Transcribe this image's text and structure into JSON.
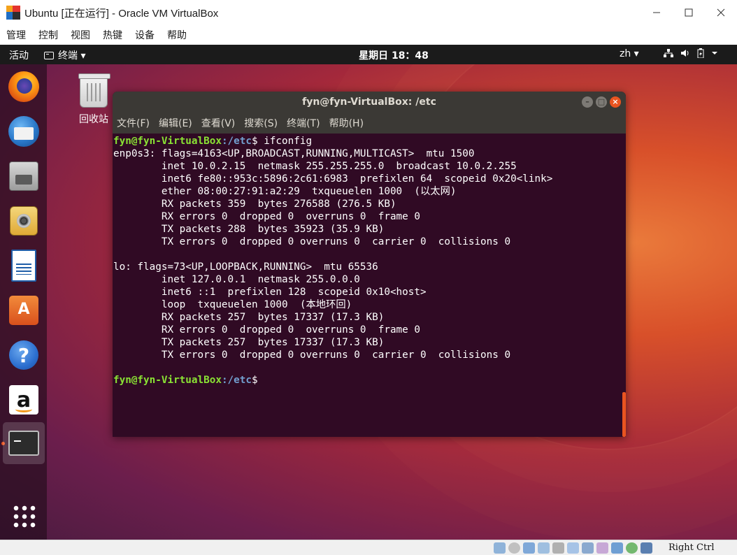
{
  "host": {
    "title": "Ubuntu [正在运行] - Oracle VM VirtualBox",
    "menu": [
      "管理",
      "控制",
      "视图",
      "热键",
      "设备",
      "帮助"
    ],
    "host_key": "Right Ctrl"
  },
  "topbar": {
    "activities": "活动",
    "app_menu": "终端 ▾",
    "clock": "星期日 18：48",
    "lang": "zh ▾"
  },
  "desktop": {
    "trash_label": "回收站"
  },
  "dock": {
    "apps": [
      "firefox",
      "thunderbird",
      "files",
      "rhythmbox",
      "libreoffice-writer",
      "ubuntu-software",
      "help",
      "amazon",
      "terminal",
      "show-applications"
    ],
    "active": "terminal"
  },
  "terminal": {
    "title": "fyn@fyn-VirtualBox: /etc",
    "menu": [
      "文件(F)",
      "编辑(E)",
      "查看(V)",
      "搜索(S)",
      "终端(T)",
      "帮助(H)"
    ],
    "prompt_user": "fyn@fyn-VirtualBox",
    "prompt_path": ":/etc",
    "command": "$ ifconfig",
    "output": [
      "enp0s3: flags=4163<UP,BROADCAST,RUNNING,MULTICAST>  mtu 1500",
      "        inet 10.0.2.15  netmask 255.255.255.0  broadcast 10.0.2.255",
      "        inet6 fe80::953c:5896:2c61:6983  prefixlen 64  scopeid 0x20<link>",
      "        ether 08:00:27:91:a2:29  txqueuelen 1000  (以太网)",
      "        RX packets 359  bytes 276588 (276.5 KB)",
      "        RX errors 0  dropped 0  overruns 0  frame 0",
      "        TX packets 288  bytes 35923 (35.9 KB)",
      "        TX errors 0  dropped 0 overruns 0  carrier 0  collisions 0",
      "",
      "lo: flags=73<UP,LOOPBACK,RUNNING>  mtu 65536",
      "        inet 127.0.0.1  netmask 255.0.0.0",
      "        inet6 ::1  prefixlen 128  scopeid 0x10<host>",
      "        loop  txqueuelen 1000  (本地环回)",
      "        RX packets 257  bytes 17337 (17.3 KB)",
      "        RX errors 0  dropped 0  overruns 0  frame 0",
      "        TX packets 257  bytes 17337 (17.3 KB)",
      "        TX errors 0  dropped 0 overruns 0  carrier 0  collisions 0",
      ""
    ],
    "final_prompt_suffix": "$"
  },
  "colors": {
    "terminal_bg": "#300a24",
    "prompt_user": "#8ae234",
    "prompt_path": "#729fcf",
    "accent": "#e95420"
  }
}
